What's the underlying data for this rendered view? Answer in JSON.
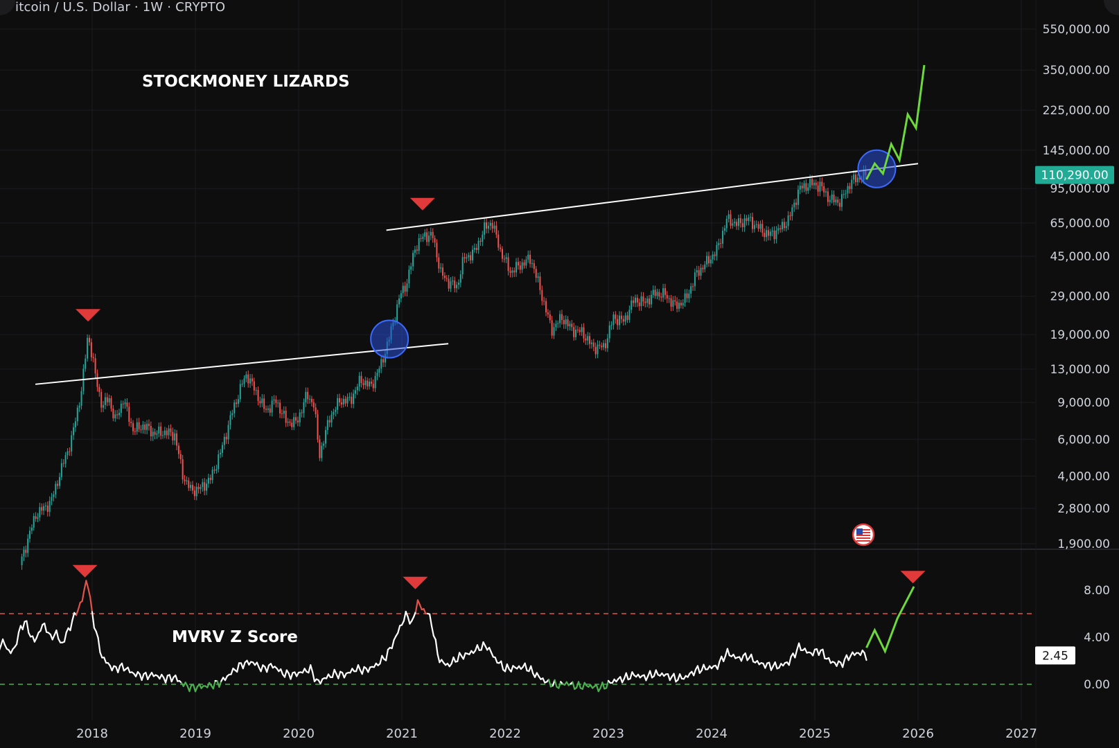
{
  "header": {
    "symbol_line": "itcoin / U.S. Dollar · 1W · CRYPTO"
  },
  "watermark": "STOCKMONEY LIZARDS",
  "indicator": {
    "name": "MVRV Z Score",
    "current_value_label": "2.45"
  },
  "colors": {
    "background": "#0e0e0f",
    "candle_up": "#26a69a",
    "candle_down": "#ef5350",
    "projection": "#6dd93c",
    "trendline": "#ffffff",
    "marker": "#e03a3a",
    "circle_fill": "#2a4fd6",
    "price_badge": "#22ab94",
    "upper_band": "#e0544c",
    "lower_band": "#4caf50"
  },
  "chart_data": [
    {
      "type": "candlestick",
      "title": "",
      "x_axis": {
        "tick_labels": [
          "2018",
          "2019",
          "2020",
          "2021",
          "2022",
          "2023",
          "2024",
          "2025",
          "2026",
          "2027"
        ]
      },
      "y_axis": {
        "scale": "log",
        "tick_labels": [
          "550,000.00",
          "350,000.00",
          "225,000.00",
          "145,000.00",
          "95,000.00",
          "65,000.00",
          "45,000.00",
          "29,000.00",
          "19,000.00",
          "13,000.00",
          "9,000.00",
          "6,000.00",
          "4,000.00",
          "2,800.00",
          "1,900.00"
        ],
        "tick_values": [
          550000,
          350000,
          225000,
          145000,
          95000,
          65000,
          45000,
          29000,
          19000,
          13000,
          9000,
          6000,
          4000,
          2800,
          1900
        ]
      },
      "current_price_label": "110,290.00",
      "current_price": 110290,
      "price_series": [
        [
          2017.3,
          1500
        ],
        [
          2017.45,
          2600
        ],
        [
          2017.6,
          3000
        ],
        [
          2017.7,
          4300
        ],
        [
          2017.8,
          6000
        ],
        [
          2017.9,
          10500
        ],
        [
          2017.96,
          19300
        ],
        [
          2018.04,
          11500
        ],
        [
          2018.1,
          8500
        ],
        [
          2018.16,
          9600
        ],
        [
          2018.22,
          7300
        ],
        [
          2018.3,
          9300
        ],
        [
          2018.4,
          6600
        ],
        [
          2018.5,
          7000
        ],
        [
          2018.6,
          6400
        ],
        [
          2018.7,
          6500
        ],
        [
          2018.8,
          6300
        ],
        [
          2018.88,
          4000
        ],
        [
          2018.96,
          3400
        ],
        [
          2019.05,
          3500
        ],
        [
          2019.15,
          3900
        ],
        [
          2019.25,
          5300
        ],
        [
          2019.35,
          7900
        ],
        [
          2019.45,
          11000
        ],
        [
          2019.5,
          12300
        ],
        [
          2019.58,
          10200
        ],
        [
          2019.68,
          8200
        ],
        [
          2019.78,
          9200
        ],
        [
          2019.88,
          7300
        ],
        [
          2019.98,
          7200
        ],
        [
          2020.08,
          9800
        ],
        [
          2020.15,
          8800
        ],
        [
          2020.2,
          5000
        ],
        [
          2020.3,
          7600
        ],
        [
          2020.4,
          9200
        ],
        [
          2020.5,
          9200
        ],
        [
          2020.6,
          11600
        ],
        [
          2020.7,
          10700
        ],
        [
          2020.8,
          13700
        ],
        [
          2020.88,
          18500
        ],
        [
          2020.98,
          29000
        ],
        [
          2021.05,
          34000
        ],
        [
          2021.13,
          50000
        ],
        [
          2021.22,
          57000
        ],
        [
          2021.3,
          56000
        ],
        [
          2021.38,
          37000
        ],
        [
          2021.45,
          34000
        ],
        [
          2021.53,
          32000
        ],
        [
          2021.6,
          44000
        ],
        [
          2021.7,
          47000
        ],
        [
          2021.8,
          61000
        ],
        [
          2021.87,
          66000
        ],
        [
          2021.96,
          47000
        ],
        [
          2022.05,
          38000
        ],
        [
          2022.15,
          41000
        ],
        [
          2022.25,
          44000
        ],
        [
          2022.35,
          30000
        ],
        [
          2022.45,
          20000
        ],
        [
          2022.55,
          23000
        ],
        [
          2022.65,
          20000
        ],
        [
          2022.75,
          19500
        ],
        [
          2022.85,
          16500
        ],
        [
          2022.96,
          16600
        ],
        [
          2023.05,
          23000
        ],
        [
          2023.15,
          22000
        ],
        [
          2023.25,
          28000
        ],
        [
          2023.35,
          27000
        ],
        [
          2023.45,
          30000
        ],
        [
          2023.55,
          29500
        ],
        [
          2023.65,
          26000
        ],
        [
          2023.75,
          28000
        ],
        [
          2023.85,
          37000
        ],
        [
          2023.96,
          42500
        ],
        [
          2024.05,
          48000
        ],
        [
          2024.15,
          68000
        ],
        [
          2024.25,
          64000
        ],
        [
          2024.35,
          68000
        ],
        [
          2024.45,
          62000
        ],
        [
          2024.55,
          57000
        ],
        [
          2024.65,
          60000
        ],
        [
          2024.75,
          68000
        ],
        [
          2024.85,
          95000
        ],
        [
          2024.96,
          100000
        ],
        [
          2025.05,
          98000
        ],
        [
          2025.15,
          84000
        ],
        [
          2025.25,
          82000
        ],
        [
          2025.35,
          103000
        ],
        [
          2025.45,
          108000
        ],
        [
          2025.5,
          110290
        ]
      ],
      "projection_series": [
        [
          2025.5,
          105000
        ],
        [
          2025.58,
          125000
        ],
        [
          2025.66,
          112000
        ],
        [
          2025.74,
          155000
        ],
        [
          2025.82,
          130000
        ],
        [
          2025.9,
          215000
        ],
        [
          2025.98,
          185000
        ],
        [
          2026.06,
          370000
        ]
      ],
      "trendlines": [
        {
          "from": [
            2017.45,
            11000
          ],
          "to": [
            2021.45,
            17200
          ]
        },
        {
          "from": [
            2020.85,
            60000
          ],
          "to": [
            2026.0,
            125000
          ]
        }
      ],
      "top_markers": [
        [
          2017.96,
          23500
        ],
        [
          2021.2,
          80000
        ]
      ],
      "breakout_circles": [
        [
          2020.88,
          18100
        ],
        [
          2025.6,
          118000
        ]
      ]
    },
    {
      "type": "line",
      "title": "MVRV Z Score",
      "y_axis": {
        "tick_labels": [
          "8.00",
          "4.00",
          "0.00"
        ],
        "tick_values": [
          8,
          4,
          0
        ]
      },
      "reference_lines": [
        6,
        0
      ],
      "series": [
        {
          "values": [
            [
              2017.0,
              3.0
            ],
            [
              2017.05,
              2.4
            ],
            [
              2017.1,
              3.2
            ],
            [
              2017.15,
              3.6
            ],
            [
              2017.2,
              2.6
            ],
            [
              2017.25,
              3.1
            ],
            [
              2017.3,
              4.6
            ],
            [
              2017.35,
              5.4
            ],
            [
              2017.4,
              4.2
            ],
            [
              2017.45,
              3.6
            ],
            [
              2017.5,
              4.8
            ],
            [
              2017.55,
              5.0
            ],
            [
              2017.6,
              3.8
            ],
            [
              2017.65,
              4.5
            ],
            [
              2017.7,
              3.3
            ],
            [
              2017.75,
              4.2
            ],
            [
              2017.8,
              5.2
            ],
            [
              2017.85,
              6.2
            ],
            [
              2017.9,
              7.0
            ],
            [
              2017.95,
              9.1
            ],
            [
              2018.0,
              6.0
            ],
            [
              2018.05,
              3.9
            ],
            [
              2018.1,
              2.2
            ],
            [
              2018.15,
              1.8
            ],
            [
              2018.2,
              1.3
            ],
            [
              2018.3,
              1.5
            ],
            [
              2018.4,
              0.9
            ],
            [
              2018.5,
              0.7
            ],
            [
              2018.6,
              0.8
            ],
            [
              2018.7,
              0.5
            ],
            [
              2018.8,
              0.6
            ],
            [
              2018.88,
              0.0
            ],
            [
              2018.96,
              -0.3
            ],
            [
              2019.05,
              -0.2
            ],
            [
              2019.15,
              -0.1
            ],
            [
              2019.25,
              0.2
            ],
            [
              2019.35,
              1.0
            ],
            [
              2019.45,
              1.7
            ],
            [
              2019.55,
              1.9
            ],
            [
              2019.65,
              1.3
            ],
            [
              2019.75,
              1.6
            ],
            [
              2019.85,
              0.9
            ],
            [
              2019.95,
              0.8
            ],
            [
              2020.05,
              1.1
            ],
            [
              2020.12,
              1.3
            ],
            [
              2020.18,
              0.1
            ],
            [
              2020.25,
              0.5
            ],
            [
              2020.35,
              0.9
            ],
            [
              2020.45,
              0.8
            ],
            [
              2020.55,
              1.3
            ],
            [
              2020.65,
              1.2
            ],
            [
              2020.75,
              1.6
            ],
            [
              2020.85,
              2.4
            ],
            [
              2020.92,
              3.6
            ],
            [
              2021.0,
              5.2
            ],
            [
              2021.05,
              6.0
            ],
            [
              2021.1,
              5.0
            ],
            [
              2021.15,
              7.1
            ],
            [
              2021.2,
              6.3
            ],
            [
              2021.25,
              6.1
            ],
            [
              2021.3,
              4.8
            ],
            [
              2021.35,
              2.3
            ],
            [
              2021.4,
              1.8
            ],
            [
              2021.45,
              1.6
            ],
            [
              2021.55,
              2.3
            ],
            [
              2021.65,
              2.6
            ],
            [
              2021.75,
              3.1
            ],
            [
              2021.82,
              3.3
            ],
            [
              2021.9,
              2.2
            ],
            [
              2022.0,
              1.3
            ],
            [
              2022.1,
              1.4
            ],
            [
              2022.2,
              1.5
            ],
            [
              2022.3,
              0.8
            ],
            [
              2022.4,
              0.2
            ],
            [
              2022.5,
              -0.1
            ],
            [
              2022.6,
              0.1
            ],
            [
              2022.7,
              -0.2
            ],
            [
              2022.8,
              -0.1
            ],
            [
              2022.9,
              -0.3
            ],
            [
              2022.96,
              -0.2
            ],
            [
              2023.05,
              0.3
            ],
            [
              2023.15,
              0.5
            ],
            [
              2023.25,
              0.8
            ],
            [
              2023.35,
              0.6
            ],
            [
              2023.45,
              0.9
            ],
            [
              2023.55,
              0.8
            ],
            [
              2023.65,
              0.5
            ],
            [
              2023.75,
              0.6
            ],
            [
              2023.85,
              1.2
            ],
            [
              2023.96,
              1.4
            ],
            [
              2024.05,
              1.5
            ],
            [
              2024.15,
              2.7
            ],
            [
              2024.25,
              2.2
            ],
            [
              2024.35,
              2.4
            ],
            [
              2024.45,
              1.8
            ],
            [
              2024.55,
              1.6
            ],
            [
              2024.65,
              1.5
            ],
            [
              2024.75,
              1.9
            ],
            [
              2024.85,
              3.2
            ],
            [
              2024.95,
              2.6
            ],
            [
              2025.05,
              2.9
            ],
            [
              2025.15,
              1.9
            ],
            [
              2025.25,
              1.7
            ],
            [
              2025.35,
              2.5
            ],
            [
              2025.45,
              2.7
            ],
            [
              2025.5,
              2.45
            ]
          ]
        }
      ],
      "projection_series": [
        [
          2025.5,
          3.1
        ],
        [
          2025.58,
          4.6
        ],
        [
          2025.68,
          2.8
        ],
        [
          2025.8,
          5.6
        ],
        [
          2025.96,
          8.3
        ]
      ],
      "top_markers": [
        [
          2017.93,
          9.6
        ],
        [
          2021.13,
          8.6
        ],
        [
          2025.95,
          9.1
        ]
      ]
    }
  ]
}
